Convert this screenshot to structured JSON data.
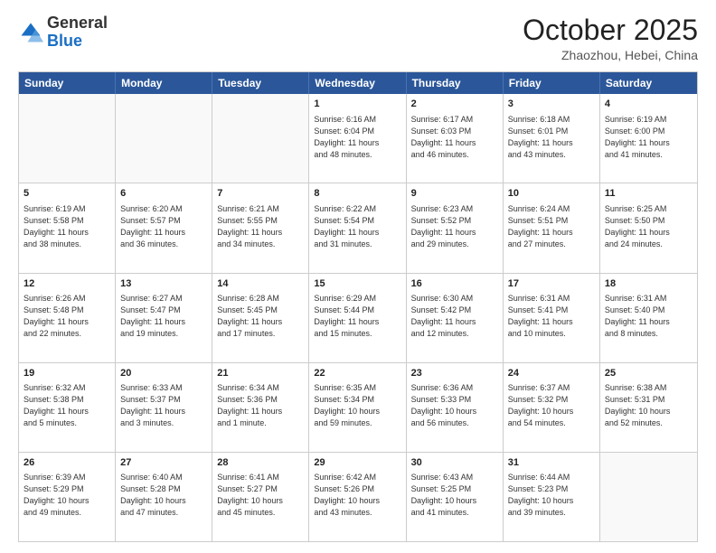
{
  "logo": {
    "general": "General",
    "blue": "Blue"
  },
  "header": {
    "month": "October 2025",
    "location": "Zhaozhou, Hebei, China"
  },
  "weekdays": [
    "Sunday",
    "Monday",
    "Tuesday",
    "Wednesday",
    "Thursday",
    "Friday",
    "Saturday"
  ],
  "rows": [
    [
      {
        "day": "",
        "lines": []
      },
      {
        "day": "",
        "lines": []
      },
      {
        "day": "",
        "lines": []
      },
      {
        "day": "1",
        "lines": [
          "Sunrise: 6:16 AM",
          "Sunset: 6:04 PM",
          "Daylight: 11 hours",
          "and 48 minutes."
        ]
      },
      {
        "day": "2",
        "lines": [
          "Sunrise: 6:17 AM",
          "Sunset: 6:03 PM",
          "Daylight: 11 hours",
          "and 46 minutes."
        ]
      },
      {
        "day": "3",
        "lines": [
          "Sunrise: 6:18 AM",
          "Sunset: 6:01 PM",
          "Daylight: 11 hours",
          "and 43 minutes."
        ]
      },
      {
        "day": "4",
        "lines": [
          "Sunrise: 6:19 AM",
          "Sunset: 6:00 PM",
          "Daylight: 11 hours",
          "and 41 minutes."
        ]
      }
    ],
    [
      {
        "day": "5",
        "lines": [
          "Sunrise: 6:19 AM",
          "Sunset: 5:58 PM",
          "Daylight: 11 hours",
          "and 38 minutes."
        ]
      },
      {
        "day": "6",
        "lines": [
          "Sunrise: 6:20 AM",
          "Sunset: 5:57 PM",
          "Daylight: 11 hours",
          "and 36 minutes."
        ]
      },
      {
        "day": "7",
        "lines": [
          "Sunrise: 6:21 AM",
          "Sunset: 5:55 PM",
          "Daylight: 11 hours",
          "and 34 minutes."
        ]
      },
      {
        "day": "8",
        "lines": [
          "Sunrise: 6:22 AM",
          "Sunset: 5:54 PM",
          "Daylight: 11 hours",
          "and 31 minutes."
        ]
      },
      {
        "day": "9",
        "lines": [
          "Sunrise: 6:23 AM",
          "Sunset: 5:52 PM",
          "Daylight: 11 hours",
          "and 29 minutes."
        ]
      },
      {
        "day": "10",
        "lines": [
          "Sunrise: 6:24 AM",
          "Sunset: 5:51 PM",
          "Daylight: 11 hours",
          "and 27 minutes."
        ]
      },
      {
        "day": "11",
        "lines": [
          "Sunrise: 6:25 AM",
          "Sunset: 5:50 PM",
          "Daylight: 11 hours",
          "and 24 minutes."
        ]
      }
    ],
    [
      {
        "day": "12",
        "lines": [
          "Sunrise: 6:26 AM",
          "Sunset: 5:48 PM",
          "Daylight: 11 hours",
          "and 22 minutes."
        ]
      },
      {
        "day": "13",
        "lines": [
          "Sunrise: 6:27 AM",
          "Sunset: 5:47 PM",
          "Daylight: 11 hours",
          "and 19 minutes."
        ]
      },
      {
        "day": "14",
        "lines": [
          "Sunrise: 6:28 AM",
          "Sunset: 5:45 PM",
          "Daylight: 11 hours",
          "and 17 minutes."
        ]
      },
      {
        "day": "15",
        "lines": [
          "Sunrise: 6:29 AM",
          "Sunset: 5:44 PM",
          "Daylight: 11 hours",
          "and 15 minutes."
        ]
      },
      {
        "day": "16",
        "lines": [
          "Sunrise: 6:30 AM",
          "Sunset: 5:42 PM",
          "Daylight: 11 hours",
          "and 12 minutes."
        ]
      },
      {
        "day": "17",
        "lines": [
          "Sunrise: 6:31 AM",
          "Sunset: 5:41 PM",
          "Daylight: 11 hours",
          "and 10 minutes."
        ]
      },
      {
        "day": "18",
        "lines": [
          "Sunrise: 6:31 AM",
          "Sunset: 5:40 PM",
          "Daylight: 11 hours",
          "and 8 minutes."
        ]
      }
    ],
    [
      {
        "day": "19",
        "lines": [
          "Sunrise: 6:32 AM",
          "Sunset: 5:38 PM",
          "Daylight: 11 hours",
          "and 5 minutes."
        ]
      },
      {
        "day": "20",
        "lines": [
          "Sunrise: 6:33 AM",
          "Sunset: 5:37 PM",
          "Daylight: 11 hours",
          "and 3 minutes."
        ]
      },
      {
        "day": "21",
        "lines": [
          "Sunrise: 6:34 AM",
          "Sunset: 5:36 PM",
          "Daylight: 11 hours",
          "and 1 minute."
        ]
      },
      {
        "day": "22",
        "lines": [
          "Sunrise: 6:35 AM",
          "Sunset: 5:34 PM",
          "Daylight: 10 hours",
          "and 59 minutes."
        ]
      },
      {
        "day": "23",
        "lines": [
          "Sunrise: 6:36 AM",
          "Sunset: 5:33 PM",
          "Daylight: 10 hours",
          "and 56 minutes."
        ]
      },
      {
        "day": "24",
        "lines": [
          "Sunrise: 6:37 AM",
          "Sunset: 5:32 PM",
          "Daylight: 10 hours",
          "and 54 minutes."
        ]
      },
      {
        "day": "25",
        "lines": [
          "Sunrise: 6:38 AM",
          "Sunset: 5:31 PM",
          "Daylight: 10 hours",
          "and 52 minutes."
        ]
      }
    ],
    [
      {
        "day": "26",
        "lines": [
          "Sunrise: 6:39 AM",
          "Sunset: 5:29 PM",
          "Daylight: 10 hours",
          "and 49 minutes."
        ]
      },
      {
        "day": "27",
        "lines": [
          "Sunrise: 6:40 AM",
          "Sunset: 5:28 PM",
          "Daylight: 10 hours",
          "and 47 minutes."
        ]
      },
      {
        "day": "28",
        "lines": [
          "Sunrise: 6:41 AM",
          "Sunset: 5:27 PM",
          "Daylight: 10 hours",
          "and 45 minutes."
        ]
      },
      {
        "day": "29",
        "lines": [
          "Sunrise: 6:42 AM",
          "Sunset: 5:26 PM",
          "Daylight: 10 hours",
          "and 43 minutes."
        ]
      },
      {
        "day": "30",
        "lines": [
          "Sunrise: 6:43 AM",
          "Sunset: 5:25 PM",
          "Daylight: 10 hours",
          "and 41 minutes."
        ]
      },
      {
        "day": "31",
        "lines": [
          "Sunrise: 6:44 AM",
          "Sunset: 5:23 PM",
          "Daylight: 10 hours",
          "and 39 minutes."
        ]
      },
      {
        "day": "",
        "lines": []
      }
    ]
  ]
}
